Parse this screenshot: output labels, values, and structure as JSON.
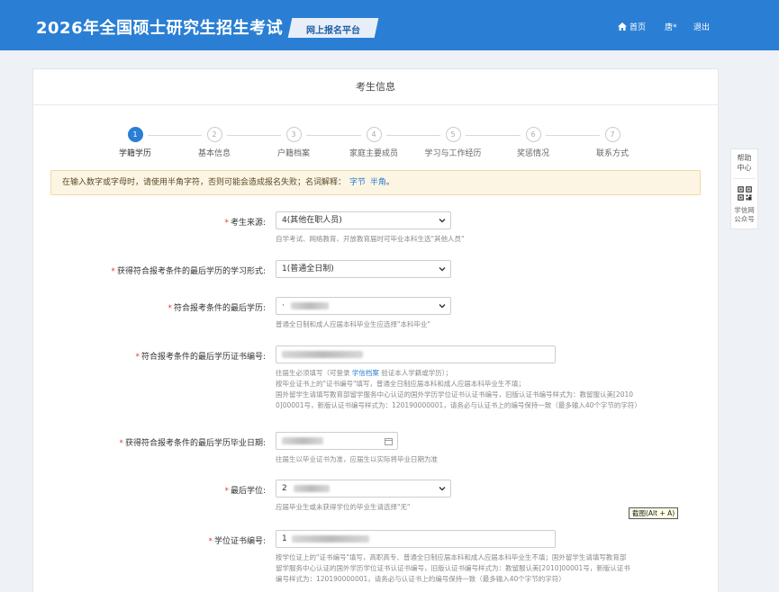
{
  "header": {
    "title": "2026年全国硕士研究生招生考试",
    "platform": "网上报名平台",
    "nav": {
      "home": "首页",
      "user": "唐*",
      "logout": "退出"
    }
  },
  "card": {
    "title": "考生信息"
  },
  "steps": [
    {
      "num": "1",
      "label": "学籍学历",
      "active": true
    },
    {
      "num": "2",
      "label": "基本信息",
      "active": false
    },
    {
      "num": "3",
      "label": "户籍档案",
      "active": false
    },
    {
      "num": "4",
      "label": "家庭主要成员",
      "active": false
    },
    {
      "num": "5",
      "label": "学习与工作经历",
      "active": false
    },
    {
      "num": "6",
      "label": "奖惩情况",
      "active": false
    },
    {
      "num": "7",
      "label": "联系方式",
      "active": false
    }
  ],
  "notice": {
    "text": "在输入数字或字母时，请使用半角字符，否则可能会造成报名失败；名词解释：",
    "link_byte": "字节",
    "link_halfwidth": "半角",
    "end": "。"
  },
  "form": {
    "source": {
      "label": "考生来源:",
      "value": "4(其他在职人员)",
      "help": "自学考试、网络教育、开放教育届时可毕业本科生选\"其他人员\""
    },
    "study_form": {
      "label": "获得符合报考条件的最后学历的学习形式:",
      "value": "1(普通全日制)"
    },
    "last_degree_level": {
      "label": "符合报考条件的最后学历:",
      "value": "·",
      "help": "普通全日制和成人应届本科毕业生应选择\"本科毕业\""
    },
    "cert_no": {
      "label": "符合报考条件的最后学历证书编号:",
      "value": "",
      "help_1a": "往届生必须填写（可登录 ",
      "help_1_link": "学信档案",
      "help_1b": " 验证本人学籍或学历）；",
      "help_2": "按毕业证书上的\"证书编号\"填写，普通全日制应届本科和成人应届本科毕业生不填；",
      "help_3": "国外留学生请填写教育部留学服务中心认证的国外学历学位证书认证书编号，旧版认证书编号样式为：教留服认美[2010",
      "help_4": "0]00001号，新版认证书编号样式为：120190000001，请务必与认证书上的编号保持一致（最多输入40个字节的字符）"
    },
    "grad_date": {
      "label": "获得符合报考条件的最后学历毕业日期:",
      "help": "往届生以毕业证书为准，应届生以实际将毕业日期为准"
    },
    "last_degree": {
      "label": "最后学位:",
      "value": "2",
      "help": "应届毕业生或未获得学位的毕业生请选择\"无\""
    },
    "degree_cert_no": {
      "label": "学位证书编号:",
      "value": "1",
      "help_1": "按学位证上的\"证书编号\"填写，高职高专、普通全日制应届本科和成人应届本科毕业生不填；国外留学生请填写教育部",
      "help_2": "留学服务中心认证的国外学历学位证书认证书编号，旧版认证书编号样式为：教留服认美[2010]00001号，新版认证书",
      "help_3": "编号样式为：120190000001，请务必与认证书上的编号保持一致（最多输入40个字节的字符）"
    }
  },
  "side": {
    "help": "帮助中心",
    "help_l1": "帮助",
    "help_l2": "中心",
    "qr_l1": "学信网",
    "qr_l2": "公众号"
  },
  "tooltip": "截图(Alt + A)",
  "colors": {
    "header": "#2a7fd4",
    "accent": "#2a7fd4",
    "required": "#e03c3c",
    "notice_bg": "#fdf5e3"
  }
}
